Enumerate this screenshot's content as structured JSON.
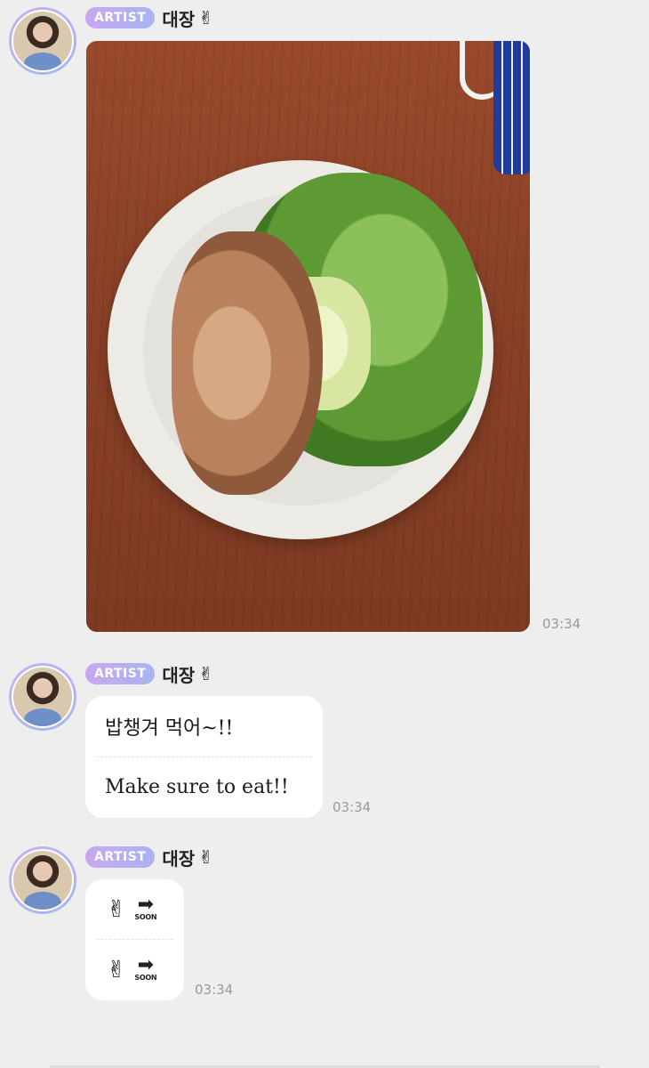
{
  "messages": [
    {
      "badge": "ARTIST",
      "sender": "대장",
      "sender_emoji": "✌",
      "type": "photo",
      "time": "03:34"
    },
    {
      "badge": "ARTIST",
      "sender": "대장",
      "sender_emoji": "✌",
      "type": "text",
      "lines": [
        "밥챙겨 먹어~!!",
        "Make sure to eat!!"
      ],
      "time": "03:34"
    },
    {
      "badge": "ARTIST",
      "sender": "대장",
      "sender_emoji": "✌",
      "type": "sticker",
      "stickers": [
        {
          "emoji": "✌",
          "arrow": "➡",
          "label": "SOON"
        },
        {
          "emoji": "✌",
          "arrow": "➡",
          "label": "SOON"
        }
      ],
      "time": "03:34"
    }
  ],
  "icons": [
    "avatar-photo",
    "peace-sign-icon",
    "soon-arrow-icon"
  ]
}
